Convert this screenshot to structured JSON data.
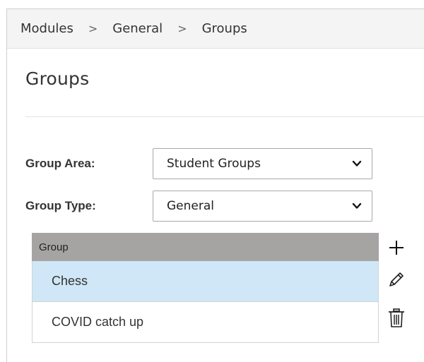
{
  "breadcrumb": {
    "items": [
      "Modules",
      "General",
      "Groups"
    ],
    "separator": ">"
  },
  "page": {
    "title": "Groups"
  },
  "filters": {
    "group_area": {
      "label": "Group Area:",
      "value": "Student Groups"
    },
    "group_type": {
      "label": "Group Type:",
      "value": "General"
    }
  },
  "group_table": {
    "header": "Group",
    "rows": [
      {
        "name": "Chess",
        "selected": true
      },
      {
        "name": "COVID catch up",
        "selected": false
      }
    ]
  },
  "actions": {
    "icons": [
      "plus-icon",
      "pencil-icon",
      "trash-icon"
    ]
  },
  "colors": {
    "header_bg": "#a6a3a3",
    "selected_row_bg": "#cfe7f6",
    "breadcrumb_bg": "#f4f4f4"
  }
}
